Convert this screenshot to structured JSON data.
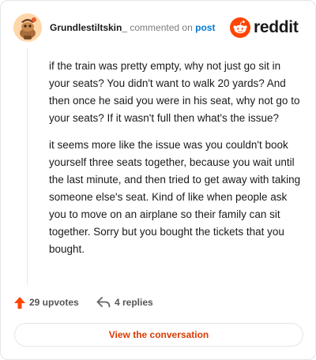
{
  "header": {
    "username": "Grundlestiltskin_",
    "action_text": "commented on",
    "target_link": "post",
    "brand_wordmark": "reddit"
  },
  "comment": {
    "paragraphs": [
      "if the train was pretty empty, why not just go sit in your seats? You didn't want to walk 20 yards? And then once he said you were in his seat, why not go to your seats? If it wasn't full then what's the issue?",
      "it seems more like the issue was you couldn't book yourself three seats together, because you wait until the last minute, and then tried to get away with taking someone else's seat. Kind of like when people ask you to move on an airplane so their family can sit together. Sorry but you bought the tickets that you bought."
    ]
  },
  "actions": {
    "upvotes_label": "29 upvotes",
    "replies_label": "4 replies"
  },
  "cta": {
    "label": "View the conversation"
  },
  "colors": {
    "brand_orange": "#ff4500",
    "upvote_red": "#ff4500",
    "link_blue": "#0079d3",
    "cta_text": "#d93a00"
  },
  "icons": {
    "avatar": "avatar-snoo-icon",
    "logo": "reddit-snoo-icon",
    "upvote": "upvote-arrow-icon",
    "reply": "reply-arrow-icon"
  }
}
